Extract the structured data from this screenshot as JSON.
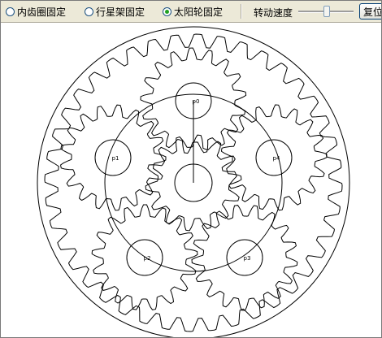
{
  "toolbar": {
    "options": [
      {
        "label": "内齿圈固定",
        "selected": false
      },
      {
        "label": "行星架固定",
        "selected": false
      },
      {
        "label": "太阳轮固定",
        "selected": true
      }
    ],
    "speed_label": "转动速度",
    "speed_value": 0.5,
    "reset_label": "复位"
  },
  "mechanism": {
    "planet_labels": [
      "p0",
      "p1",
      "p2",
      "p3",
      "p4"
    ]
  }
}
